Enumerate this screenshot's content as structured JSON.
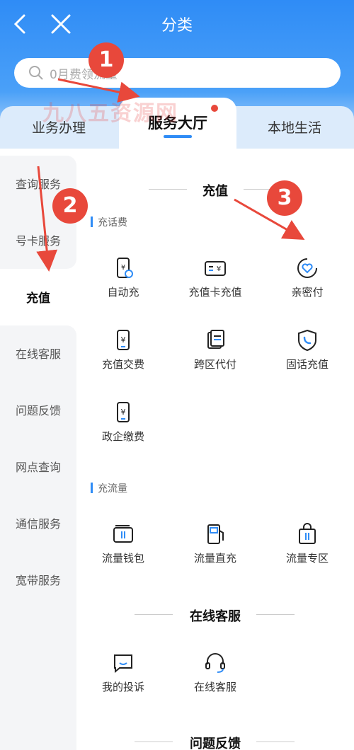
{
  "header": {
    "title": "分类"
  },
  "search": {
    "placeholder": "0月费领流量"
  },
  "tabs": {
    "left": "业务办理",
    "active": "服务大厅",
    "right": "本地生活"
  },
  "watermark": "九八五资源网",
  "sidebar": {
    "items": [
      "查询服务",
      "号卡服务",
      "充值",
      "在线客服",
      "问题反馈",
      "网点查询",
      "通信服务",
      "宽带服务"
    ]
  },
  "recharge": {
    "title": "充值",
    "sub1": "充话费",
    "sub1_items": [
      "自动充",
      "充值卡充值",
      "亲密付",
      "充值交费",
      "跨区代付",
      "固话充值",
      "政企缴费"
    ],
    "sub2": "充流量",
    "sub2_items": [
      "流量钱包",
      "流量直充",
      "流量专区"
    ]
  },
  "online": {
    "title": "在线客服",
    "items": [
      "我的投诉",
      "在线客服"
    ]
  },
  "feedback": {
    "title": "问题反馈"
  },
  "annotations": [
    "1",
    "2",
    "3"
  ],
  "colors": {
    "primary": "#2f8cf6",
    "annotation": "#e8483b"
  }
}
